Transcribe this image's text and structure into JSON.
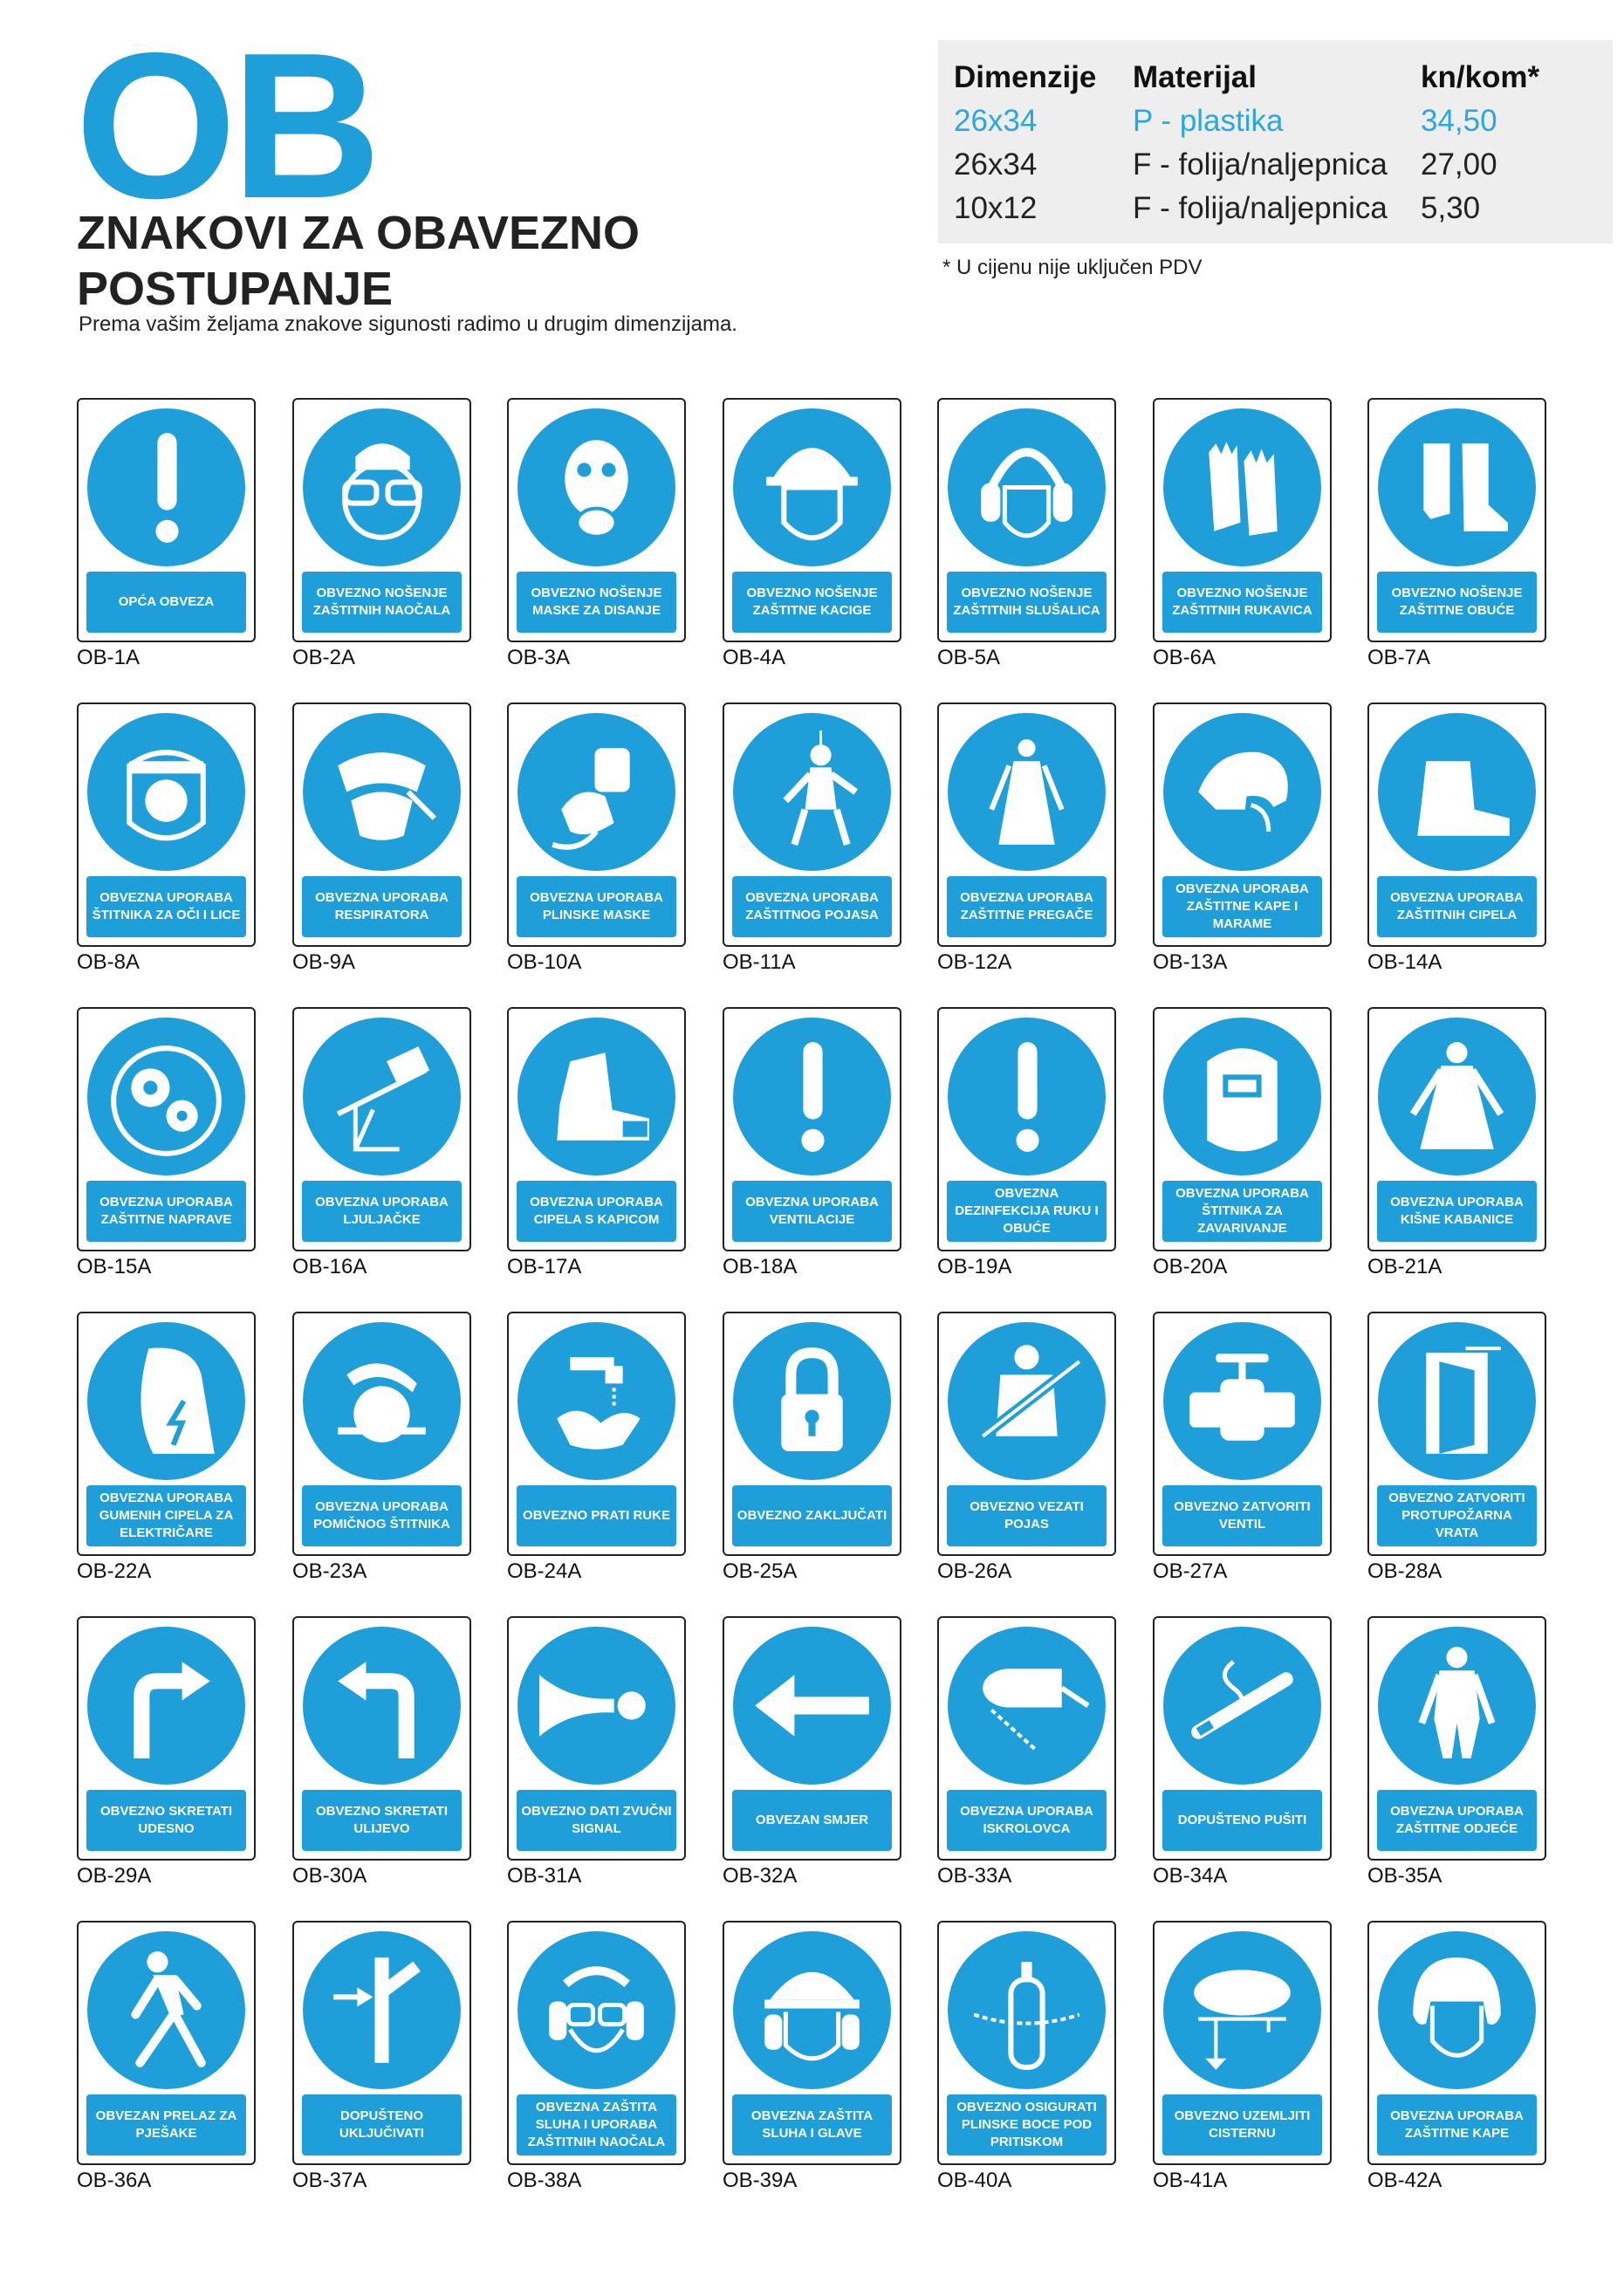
{
  "header": {
    "logo": "OB",
    "title": "ZNAKOVI ZA OBAVEZNO POSTUPANJE",
    "subtitle": "Prema vašim željama znakove sigunosti radimo u drugim dimenzijama."
  },
  "price_table": {
    "headers": [
      "Dimenzije",
      "Materijal",
      "kn/kom*"
    ],
    "rows": [
      [
        "26x34",
        "P - plastika",
        "34,50"
      ],
      [
        "26x34",
        "F - folija/naljepnica",
        "27,00"
      ],
      [
        "10x12",
        "F - folija/naljepnica",
        "5,30"
      ]
    ],
    "note": "* U cijenu nije uključen PDV",
    "highlight_color": "#29a8e0"
  },
  "colors": {
    "sign_blue": "#1e9fd9"
  },
  "signs": [
    {
      "code": "OB-1A",
      "label": "OPĆA OBVEZA",
      "icon": "exclamation-icon"
    },
    {
      "code": "OB-2A",
      "label": "OBVEZNO NOŠENJE ZAŠTITNIH NAOČALA",
      "icon": "goggles-icon"
    },
    {
      "code": "OB-3A",
      "label": "OBVEZNO NOŠENJE MASKE ZA DISANJE",
      "icon": "gas-mask-icon"
    },
    {
      "code": "OB-4A",
      "label": "OBVEZNO NOŠENJE ZAŠTITNE KACIGE",
      "icon": "helmet-icon"
    },
    {
      "code": "OB-5A",
      "label": "OBVEZNO NOŠENJE ZAŠTITNIH SLUŠALICA",
      "icon": "ear-protection-icon"
    },
    {
      "code": "OB-6A",
      "label": "OBVEZNO NOŠENJE ZAŠTITNIH RUKAVICA",
      "icon": "gloves-icon"
    },
    {
      "code": "OB-7A",
      "label": "OBVEZNO NOŠENJE ZAŠTITNE OBUĆE",
      "icon": "boots-icon"
    },
    {
      "code": "OB-8A",
      "label": "OBVEZNA UPORABA ŠTITNIKA ZA OČI I LICE",
      "icon": "face-shield-icon"
    },
    {
      "code": "OB-9A",
      "label": "OBVEZNA UPORABA RESPIRATORA",
      "icon": "respirator-icon"
    },
    {
      "code": "OB-10A",
      "label": "OBVEZNA UPORABA PLINSKE MASKE",
      "icon": "gas-mask-canister-icon"
    },
    {
      "code": "OB-11A",
      "label": "OBVEZNA UPORABA ZAŠTITNOG POJASA",
      "icon": "safety-harness-icon"
    },
    {
      "code": "OB-12A",
      "label": "OBVEZNA UPORABA ZAŠTITNE PREGAČE",
      "icon": "apron-icon"
    },
    {
      "code": "OB-13A",
      "label": "OBVEZNA UPORABA ZAŠTITNE KAPE I MARAME",
      "icon": "cap-scarf-icon"
    },
    {
      "code": "OB-14A",
      "label": "OBVEZNA UPORABA ZAŠTITNIH CIPELA",
      "icon": "shoe-icon"
    },
    {
      "code": "OB-15A",
      "label": "OBVEZNA UPORABA ZAŠTITNE NAPRAVE",
      "icon": "gear-guard-icon"
    },
    {
      "code": "OB-16A",
      "label": "OBVEZNA UPORABA LJULJAČKE",
      "icon": "swing-seat-icon"
    },
    {
      "code": "OB-17A",
      "label": "OBVEZNA UPORABA CIPELA S KAPICOM",
      "icon": "toecap-shoe-icon"
    },
    {
      "code": "OB-18A",
      "label": "OBVEZNA UPORABA VENTILACIJE",
      "icon": "exclamation-icon"
    },
    {
      "code": "OB-19A",
      "label": "OBVEZNA DEZINFEKCIJA RUKU I OBUĆE",
      "icon": "exclamation-icon"
    },
    {
      "code": "OB-20A",
      "label": "OBVEZNA UPORABA ŠTITNIKA ZA ZAVARIVANJE",
      "icon": "welding-mask-icon"
    },
    {
      "code": "OB-21A",
      "label": "OBVEZNA UPORABA KIŠNE KABANICE",
      "icon": "raincoat-icon"
    },
    {
      "code": "OB-22A",
      "label": "OBVEZNA UPORABA GUMENIH CIPELA ZA ELEKTRIČARE",
      "icon": "electric-boot-icon"
    },
    {
      "code": "OB-23A",
      "label": "OBVEZNA UPORABA POMIČNOG ŠTITNIKA",
      "icon": "saw-guard-icon"
    },
    {
      "code": "OB-24A",
      "label": "OBVEZNO PRATI RUKE",
      "icon": "wash-hands-icon"
    },
    {
      "code": "OB-25A",
      "label": "OBVEZNO ZAKLJUČATI",
      "icon": "padlock-icon"
    },
    {
      "code": "OB-26A",
      "label": "OBVEZNO VEZATI POJAS",
      "icon": "seat-belt-icon"
    },
    {
      "code": "OB-27A",
      "label": "OBVEZNO ZATVORITI VENTIL",
      "icon": "valve-icon"
    },
    {
      "code": "OB-28A",
      "label": "OBVEZNO ZATVORITI PROTUPOŽARNA VRATA",
      "icon": "fire-door-icon"
    },
    {
      "code": "OB-29A",
      "label": "OBVEZNO SKRETATI UDESNO",
      "icon": "turn-right-icon"
    },
    {
      "code": "OB-30A",
      "label": "OBVEZNO SKRETATI ULIJEVO",
      "icon": "turn-left-icon"
    },
    {
      "code": "OB-31A",
      "label": "OBVEZNO DATI ZVUČNI SIGNAL",
      "icon": "horn-icon"
    },
    {
      "code": "OB-32A",
      "label": "OBVEZAN SMJER",
      "icon": "arrow-left-icon"
    },
    {
      "code": "OB-33A",
      "label": "OBVEZNA UPORABA ISKROLOVCA",
      "icon": "spark-arrester-icon"
    },
    {
      "code": "OB-34A",
      "label": "DOPUŠTENO PUŠITI",
      "icon": "cigarette-icon"
    },
    {
      "code": "OB-35A",
      "label": "OBVEZNA UPORABA ZAŠTITNE ODJEĆE",
      "icon": "coverall-icon"
    },
    {
      "code": "OB-36A",
      "label": "OBVEZAN PRELAZ ZA PJEŠAKE",
      "icon": "pedestrian-icon"
    },
    {
      "code": "OB-37A",
      "label": "DOPUŠTENO UKLJUČIVATI",
      "icon": "switch-on-icon"
    },
    {
      "code": "OB-38A",
      "label": "OBVEZNA ZAŠTITA SLUHA I UPORABA ZAŠTITNIH NAOČALA",
      "icon": "ear-goggles-icon"
    },
    {
      "code": "OB-39A",
      "label": "OBVEZNA ZAŠTITA SLUHA I GLAVE",
      "icon": "helmet-ear-icon"
    },
    {
      "code": "OB-40A",
      "label": "OBVEZNO OSIGURATI PLINSKE BOCE POD PRITISKOM",
      "icon": "gas-cylinder-icon"
    },
    {
      "code": "OB-41A",
      "label": "OBVEZNO UZEMLJITI CISTERNU",
      "icon": "ground-tank-icon"
    },
    {
      "code": "OB-42A",
      "label": "OBVEZNA UPORABA ZAŠTITNE KAPE",
      "icon": "hairnet-icon"
    }
  ]
}
